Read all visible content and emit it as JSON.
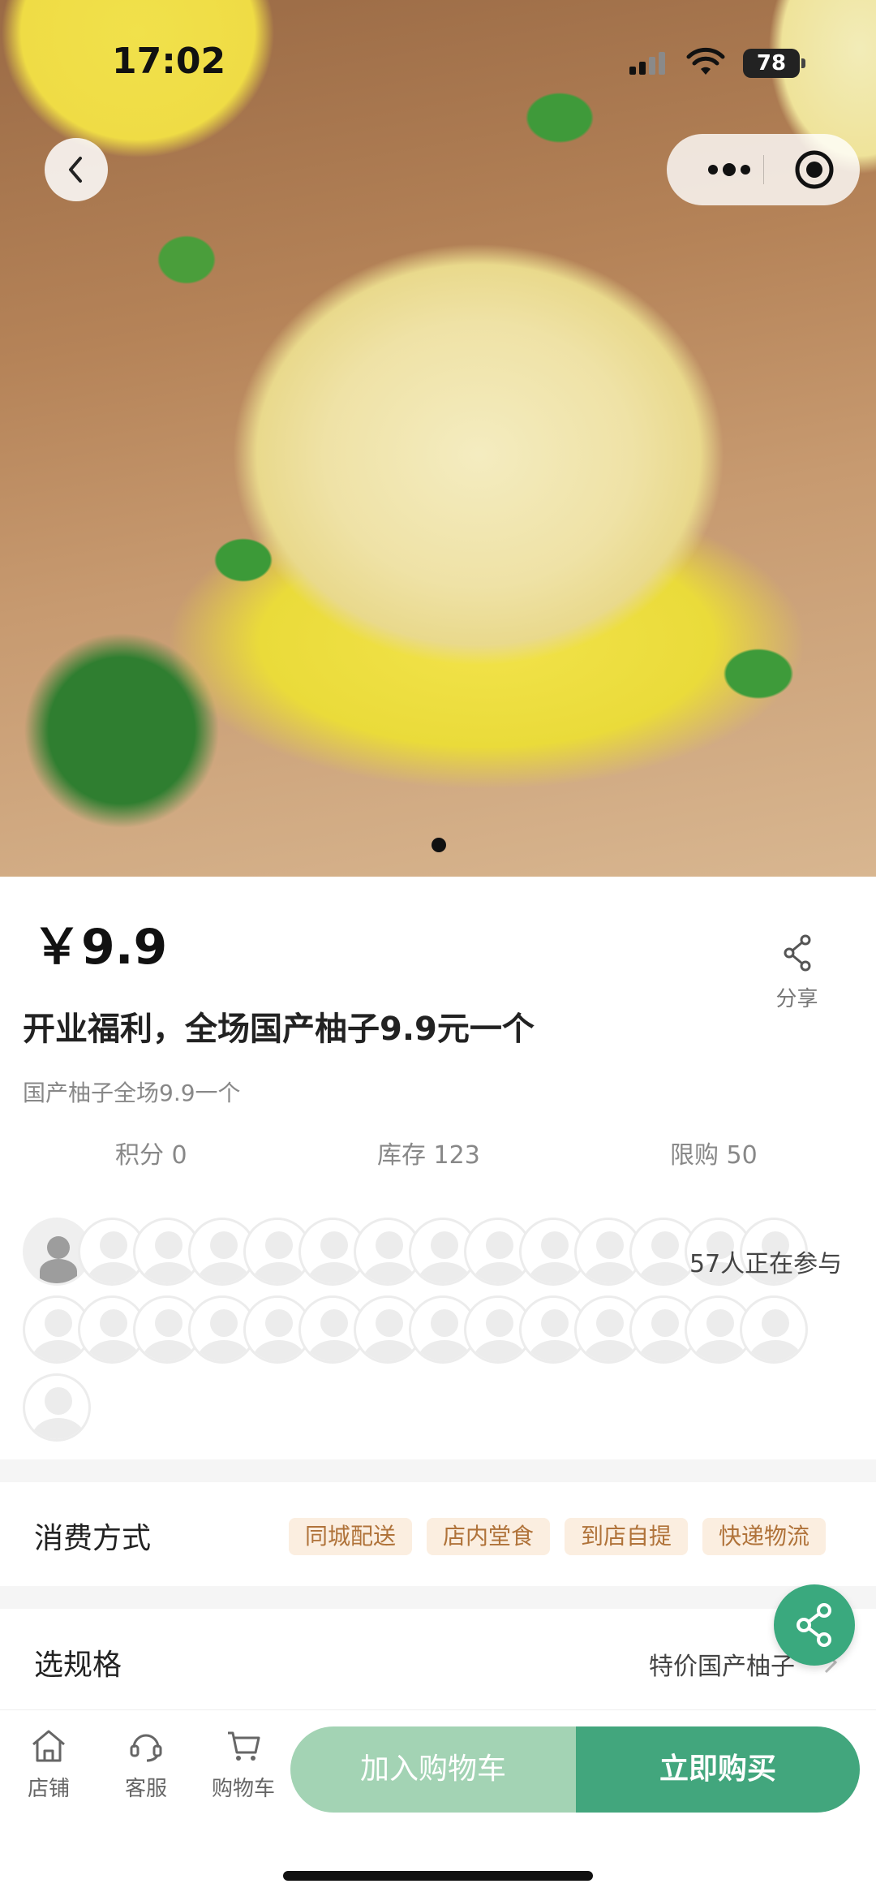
{
  "status_bar": {
    "time": "17:02",
    "battery": "78"
  },
  "product": {
    "price": "￥9.9",
    "title": "开业福利，全场国产柚子9.9元一个",
    "subtitle": "国产柚子全场9.9一个",
    "share_label": "分享",
    "stats": {
      "points": "积分 0",
      "stock": "库存 123",
      "limit": "限购 50"
    },
    "participants": "57人正在参与"
  },
  "consume": {
    "label": "消费方式",
    "tags": [
      "同城配送",
      "店内堂食",
      "到店自提",
      "快递物流"
    ]
  },
  "spec": {
    "label": "选规格",
    "value": "特价国产柚子"
  },
  "bottom_nav": {
    "shop": "店铺",
    "service": "客服",
    "cart": "购物车",
    "add_to_cart": "加入购物车",
    "buy_now": "立即购买"
  },
  "colors": {
    "primary_green": "#42a67d",
    "light_green": "#a3d3b4",
    "tag_bg": "#fbeee0",
    "tag_text": "#b0733a"
  },
  "icons": [
    "back-icon",
    "more-icon",
    "target-icon",
    "share-icon",
    "home-icon",
    "service-icon",
    "cart-icon",
    "chevron-right-icon"
  ]
}
